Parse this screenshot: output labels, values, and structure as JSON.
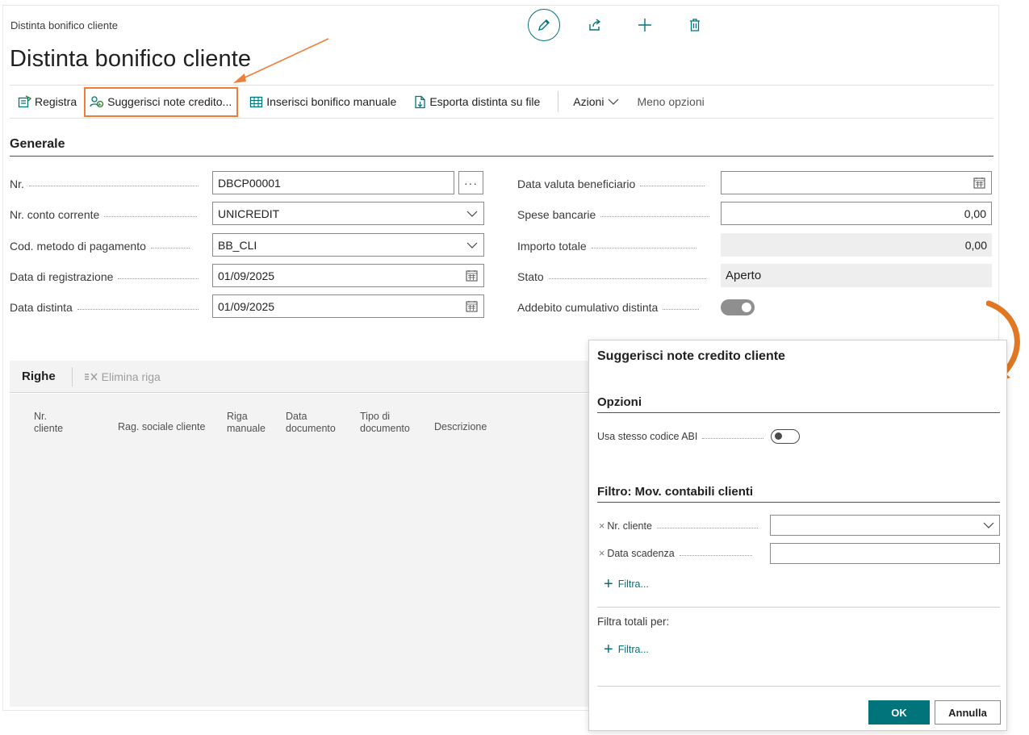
{
  "page": {
    "breadcrumb": "Distinta bonifico cliente",
    "title": "Distinta bonifico cliente"
  },
  "toolbar": {
    "registra": "Registra",
    "suggerisci": "Suggerisci note credito...",
    "inserisci": "Inserisci bonifico manuale",
    "esporta": "Esporta distinta su file",
    "azioni": "Azioni",
    "meno_opzioni": "Meno opzioni"
  },
  "generale": {
    "section_title": "Generale",
    "nr": {
      "label": "Nr.",
      "value": "DBCP00001",
      "more": "···"
    },
    "conto": {
      "label": "Nr. conto corrente",
      "value": "UNICREDIT"
    },
    "metodo": {
      "label": "Cod. metodo di pagamento",
      "value": "BB_CLI"
    },
    "data_reg": {
      "label": "Data di registrazione",
      "value": "01/09/2025"
    },
    "data_distinta": {
      "label": "Data distinta",
      "value": "01/09/2025"
    },
    "data_valuta": {
      "label": "Data valuta beneficiario",
      "value": ""
    },
    "spese": {
      "label": "Spese bancarie",
      "value": "0,00"
    },
    "importo": {
      "label": "Importo totale",
      "value": "0,00"
    },
    "stato": {
      "label": "Stato",
      "value": "Aperto"
    },
    "addebito": {
      "label": "Addebito cumulativo distinta",
      "value": true
    }
  },
  "righe": {
    "title": "Righe",
    "elimina": "Elimina riga",
    "columns": [
      {
        "line1": "Nr.",
        "line2": "cliente"
      },
      {
        "line1": "Rag. sociale cliente",
        "line2": ""
      },
      {
        "line1": "Riga",
        "line2": "manuale"
      },
      {
        "line1": "Data",
        "line2": "documento"
      },
      {
        "line1": "Tipo di",
        "line2": "documento"
      },
      {
        "line1": "Descrizione",
        "line2": ""
      }
    ]
  },
  "dialog": {
    "title": "Suggerisci note credito cliente",
    "opzioni": "Opzioni",
    "usa_abi": {
      "label": "Usa stesso codice ABI",
      "value": false
    },
    "filtro_title": "Filtro: Mov. contabili clienti",
    "filter_nr_cliente": "Nr. cliente",
    "filter_data_scadenza": "Data scadenza",
    "filtra": "Filtra...",
    "filtra_totali": "Filtra totali per:",
    "filtra2": "Filtra...",
    "ok": "OK",
    "annulla": "Annulla"
  },
  "colors": {
    "accent": "#00747a",
    "highlight": "#ef7d3a"
  }
}
